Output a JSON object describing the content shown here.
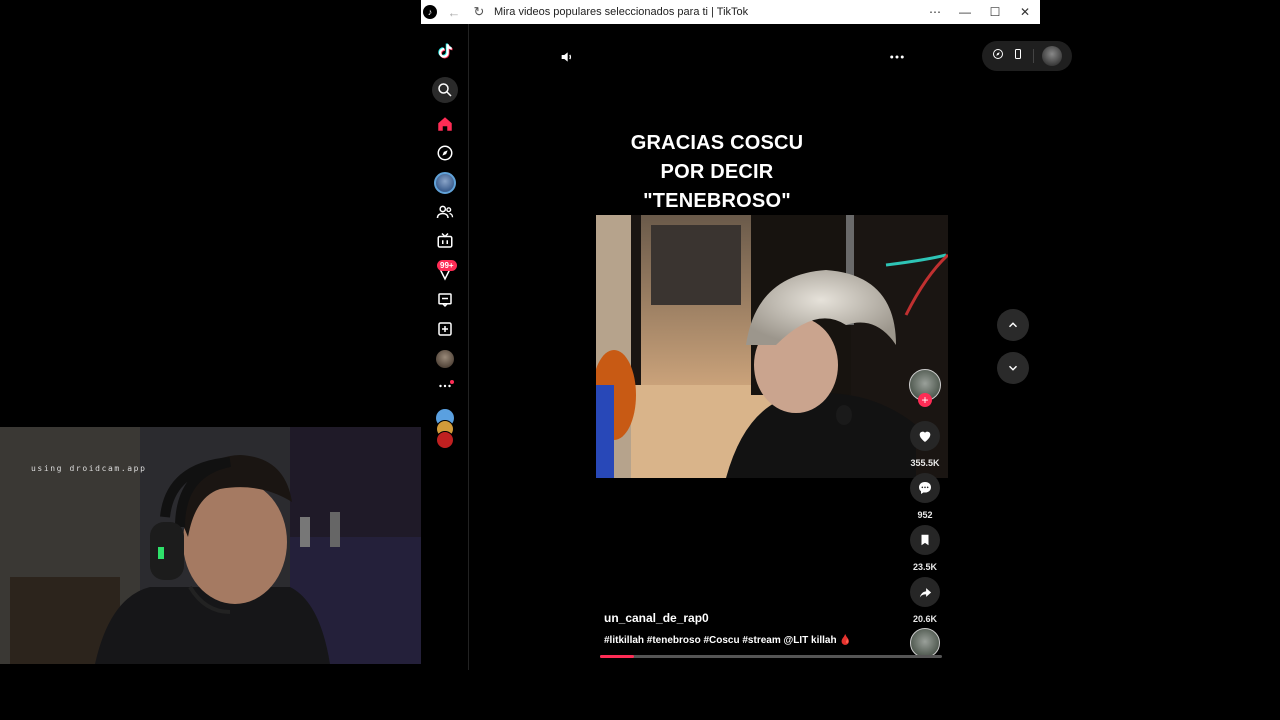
{
  "browser": {
    "title": "Mira videos populares seleccionados para ti | TikTok",
    "icons": [
      "tiktok-icon",
      "back-icon",
      "reload-icon",
      "more-icon",
      "minimize-icon",
      "maximize-icon",
      "close-icon"
    ]
  },
  "sidebar": {
    "items": [
      "tiktok-logo",
      "search",
      "home",
      "explore",
      "following-avatar",
      "friends",
      "live",
      "activity",
      "messages",
      "upload",
      "profile",
      "more"
    ],
    "activity_badge": "99+"
  },
  "video": {
    "caption_lines": [
      "GRACIAS COSCU",
      "POR DECIR",
      "\"TENEBROSO\""
    ],
    "username": "un_canal_de_rap0",
    "hashtags": "#litkillah #tenebroso #Coscu #stream @LIT killah 🩸",
    "progress": 0.1
  },
  "actions": {
    "likes": "355.5K",
    "comments": "952",
    "saves": "23.5K",
    "shares": "20.6K"
  },
  "webcam": {
    "label": "using droidcam.app"
  },
  "colors": {
    "accent": "#fe2c55",
    "background": "#000000"
  }
}
